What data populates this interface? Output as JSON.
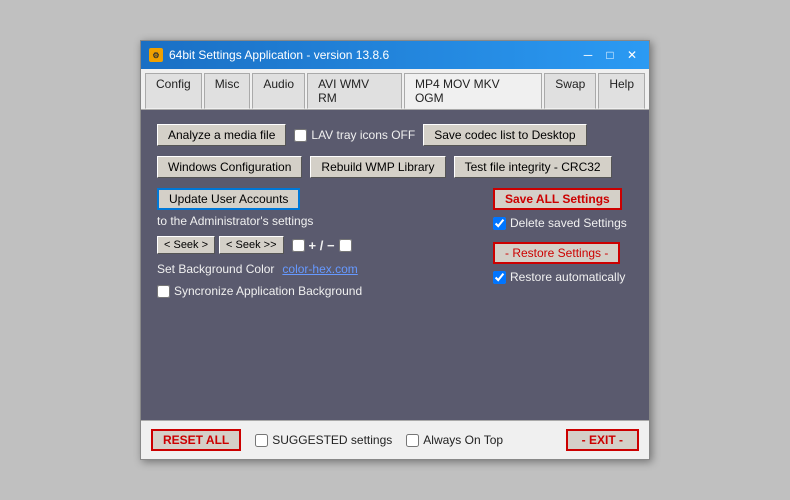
{
  "window": {
    "title": "64bit Settings Application - version 13.8.6",
    "icon_label": "S",
    "min_btn": "─",
    "max_btn": "□",
    "close_btn": "✕"
  },
  "tabs": [
    {
      "label": "Config",
      "active": false
    },
    {
      "label": "Misc",
      "active": false
    },
    {
      "label": "Audio",
      "active": false
    },
    {
      "label": "AVI WMV RM",
      "active": false
    },
    {
      "label": "MP4 MOV MKV OGM",
      "active": true
    },
    {
      "label": "Swap",
      "active": false
    },
    {
      "label": "Help",
      "active": false
    }
  ],
  "content": {
    "row1": {
      "analyze_btn": "Analyze a media file",
      "lav_checkbox_label": "LAV tray icons OFF",
      "save_codec_btn": "Save codec list to Desktop"
    },
    "row2": {
      "windows_config_btn": "Windows Configuration",
      "rebuild_wmp_btn": "Rebuild WMP Library",
      "test_integrity_btn": "Test file integrity - CRC32"
    },
    "row3": {
      "update_accounts_btn": "Update User Accounts",
      "to_admin_text": "to the Administrator's settings",
      "save_all_btn": "Save ALL Settings",
      "delete_saved_label": "Delete saved Settings"
    },
    "row4": {
      "seek_left_btn": "< Seek >",
      "seek_right_btn": "< Seek >>",
      "plus_minus": "+ / −",
      "restore_btn": "- Restore Settings -",
      "restore_auto_label": "Restore automatically"
    },
    "row5": {
      "set_bg_label": "Set Background Color",
      "color_hex_link": "color-hex.com"
    },
    "row6": {
      "sync_bg_label": "Syncronize Application Background"
    }
  },
  "bottom_bar": {
    "reset_btn": "RESET ALL",
    "suggested_label": "SUGGESTED settings",
    "always_top_label": "Always On Top",
    "exit_btn": "- EXIT -"
  }
}
